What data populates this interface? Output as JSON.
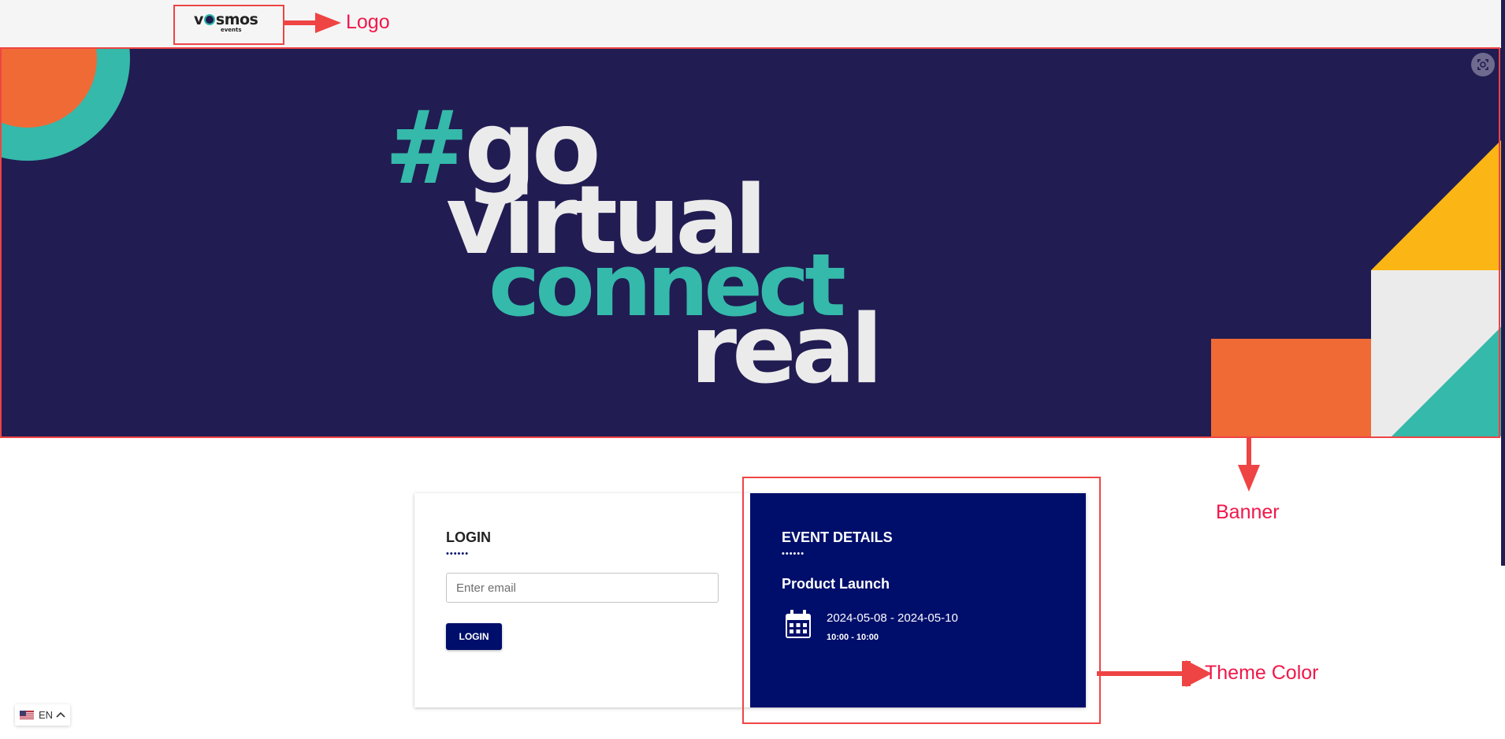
{
  "logo": {
    "text_before": "v",
    "text_after": "smos",
    "sub": "events"
  },
  "banner": {
    "line1_hash": "#",
    "line1_word": "go",
    "line2": "virtual",
    "line3": "connect",
    "line4": "real"
  },
  "login": {
    "title": "LOGIN",
    "dots": "••••••",
    "email_placeholder": "Enter email",
    "button": "LOGIN"
  },
  "event_details": {
    "title": "EVENT DETAILS",
    "dots": "••••••",
    "event_name": "Product Launch",
    "date_range": "2024-05-08 - 2024-05-10",
    "time_range": "10:00 - 10:00"
  },
  "language": {
    "code": "EN"
  },
  "annotations": {
    "logo": "Logo",
    "banner": "Banner",
    "theme_color": "Theme Color"
  },
  "colors": {
    "theme": "#000e6b",
    "banner_bg": "#211c52",
    "teal": "#35b9aa",
    "orange": "#f06a35",
    "yellow": "#fbb615",
    "light_gray": "#ebebeb",
    "annotation_red": "#ef4444"
  },
  "icons": [
    "calendar-icon",
    "focus-icon",
    "us-flag-icon",
    "chevron-up-icon",
    "arrow-icon"
  ]
}
